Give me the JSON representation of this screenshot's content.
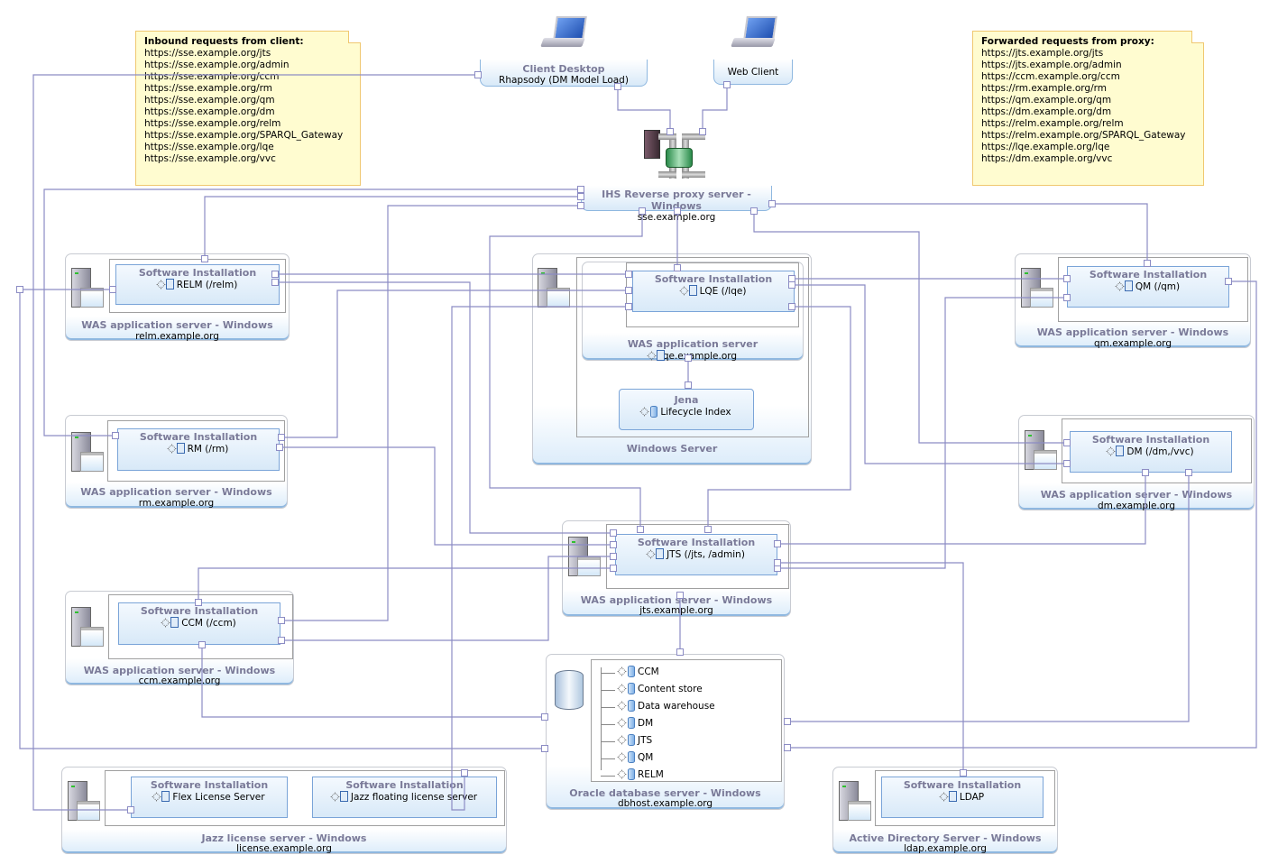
{
  "notes": {
    "inbound": {
      "title": "Inbound requests from client:",
      "lines": [
        "https://sse.example.org/jts",
        "https://sse.example.org/admin",
        "https://sse.example.org/ccm",
        "https://sse.example.org/rm",
        "https://sse.example.org/qm",
        "https://sse.example.org/dm",
        "https://sse.example.org/relm",
        "https://sse.example.org/SPARQL_Gateway",
        "https://sse.example.org/lqe",
        "https://sse.example.org/vvc"
      ]
    },
    "forwarded": {
      "title": "Forwarded requests from proxy:",
      "lines": [
        "https://jts.example.org/jts",
        "https://jts.example.org/admin",
        "https://ccm.example.org/ccm",
        "https://rm.example.org/rm",
        "https://qm.example.org/qm",
        "https://dm.example.org/dm",
        "https://relm.example.org/relm",
        "https://relm.example.org/SPARQL_Gateway",
        "https://lqe.example.org/lqe",
        "https://dm.example.org/vvc"
      ]
    }
  },
  "clients": {
    "desktop": {
      "title": "Client Desktop",
      "subtitle": "Rhapsody (DM Model Load)"
    },
    "web": {
      "title": "Web Client"
    }
  },
  "proxy": {
    "title": "IHS Reverse proxy server - Windows",
    "host": "sse.example.org"
  },
  "sw_title": "Software Installation",
  "servers": {
    "relm": {
      "title": "WAS application server - Windows",
      "host": "relm.example.org",
      "app": "RELM (/relm)"
    },
    "rm": {
      "title": "WAS application server - Windows",
      "host": "rm.example.org",
      "app": "RM (/rm)"
    },
    "ccm": {
      "title": "WAS application server - Windows",
      "host": "ccm.example.org",
      "app": "CCM (/ccm)"
    },
    "qm": {
      "title": "WAS application server - Windows",
      "host": "qm.example.org",
      "app": "QM (/qm)"
    },
    "dm": {
      "title": "WAS application server - Windows",
      "host": "dm.example.org",
      "app": "DM (/dm,/vvc)"
    },
    "jts": {
      "title": "WAS application server - Windows",
      "host": "jts.example.org",
      "app": "JTS (/jts, /admin)"
    },
    "lqe": {
      "outer_title": "Windows Server",
      "was_title": "WAS application server",
      "host": "lqe.example.org",
      "app": "LQE (/lqe)",
      "jena_title": "Jena",
      "jena_item": "Lifecycle Index"
    },
    "db": {
      "title": "Oracle database server - Windows",
      "host": "dbhost.example.org",
      "databases": [
        "CCM",
        "Content store",
        "Data warehouse",
        "DM",
        "JTS",
        "QM",
        "RELM"
      ]
    },
    "license": {
      "title": "Jazz license server - Windows",
      "host": "license.example.org",
      "app1": "Flex License Server",
      "app2": "Jazz floating license server"
    },
    "ldap": {
      "title": "Active Directory Server - Windows",
      "host": "ldap.example.org",
      "app": "LDAP"
    }
  },
  "colors": {
    "wire": "#8c8cc4",
    "note_bg": "#fffcd0",
    "node_title": "#7a7a98"
  }
}
